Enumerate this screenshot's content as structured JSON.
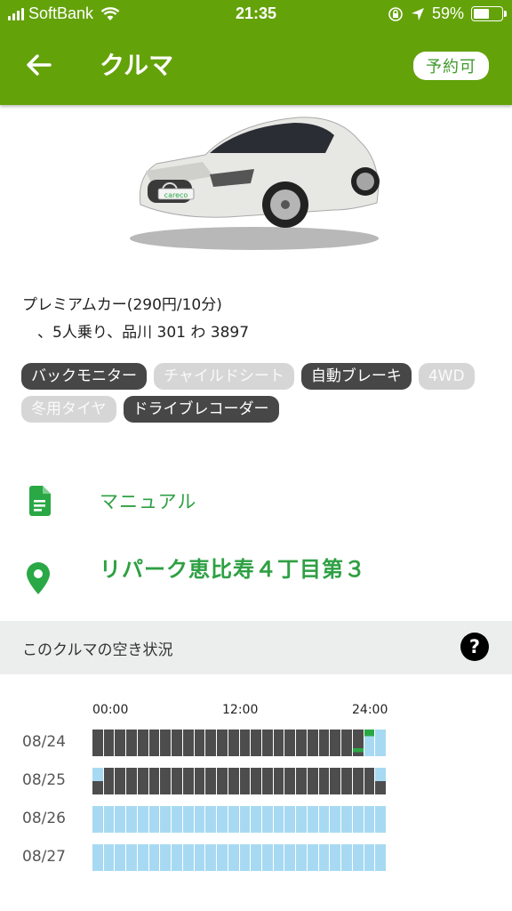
{
  "status_bar": {
    "carrier": "SoftBank",
    "time": "21:35",
    "battery": "59%",
    "battery_level": 0.59
  },
  "nav": {
    "title": "クルマ",
    "badge": "予約可"
  },
  "car": {
    "plate_brand": "careco",
    "description_line1": "プレミアムカー(290円/10分)",
    "description_line2": "　、5人乗り、品川 301 わ 3897"
  },
  "tags": [
    {
      "label": "バックモニター",
      "active": true
    },
    {
      "label": "チャイルドシート",
      "active": false
    },
    {
      "label": "自動ブレーキ",
      "active": true
    },
    {
      "label": "4WD",
      "active": false
    },
    {
      "label": "冬用タイヤ",
      "active": false
    },
    {
      "label": "ドライブレコーダー",
      "active": true
    }
  ],
  "manual_label": "マニュアル",
  "location_label": "リパーク恵比寿４丁目第３",
  "availability": {
    "header": "このクルマの空き状況",
    "help_glyph": "?",
    "time_labels": [
      "00:00",
      "12:00",
      "24:00"
    ],
    "colors": {
      "free": "#a7daf2",
      "booked": "#4d4d4d",
      "mine": "#2aa845"
    },
    "rows": [
      {
        "date": "08/24",
        "slots": "BBBBBBBBBBBBBBBBBBBBBBBXGF"
      },
      {
        "date": "08/25",
        "slots": "HBBBBBBBBBBBBBBBBBBBBBBBBH"
      },
      {
        "date": "08/26",
        "slots": "FFFFFFFFFFFFFFFFFFFFFFFFFF"
      },
      {
        "date": "08/27",
        "slots": "FFFFFFFFFFFFFFFFFFFFFFFFFF"
      }
    ]
  }
}
